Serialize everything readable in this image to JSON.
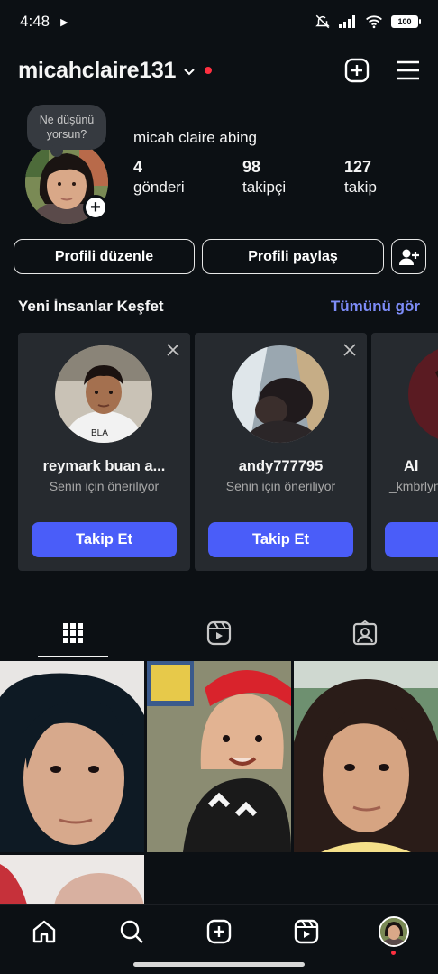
{
  "status_bar": {
    "time": "4:48",
    "battery": "100"
  },
  "header": {
    "username": "micahclaire131"
  },
  "profile": {
    "note": "Ne düşünü yorsun?",
    "display_name": "micah claire abing",
    "stats": [
      {
        "value": "4",
        "label": "gönderi"
      },
      {
        "value": "98",
        "label": "takipçi"
      },
      {
        "value": "127",
        "label": "takip"
      }
    ]
  },
  "buttons": {
    "edit_profile": "Profili düzenle",
    "share_profile": "Profili paylaş"
  },
  "discover": {
    "title": "Yeni İnsanlar Keşfet",
    "see_all": "Tümünü gör",
    "cards": [
      {
        "name": "reymark buan a...",
        "subtitle": "Senin için öneriliyor",
        "button": "Takip Et"
      },
      {
        "name": "andy777795",
        "subtitle": "Senin için öneriliyor",
        "button": "Takip Et"
      },
      {
        "name": "Al",
        "subtitle": "_kmbrlyn",
        "button": "T"
      }
    ]
  },
  "tabs": [
    "grid-tab",
    "reels-tab",
    "tagged-tab"
  ],
  "colors": {
    "accent": "#4a5df9",
    "link": "#7d8cf8",
    "background": "#0c1014",
    "notification": "#ff3040"
  }
}
